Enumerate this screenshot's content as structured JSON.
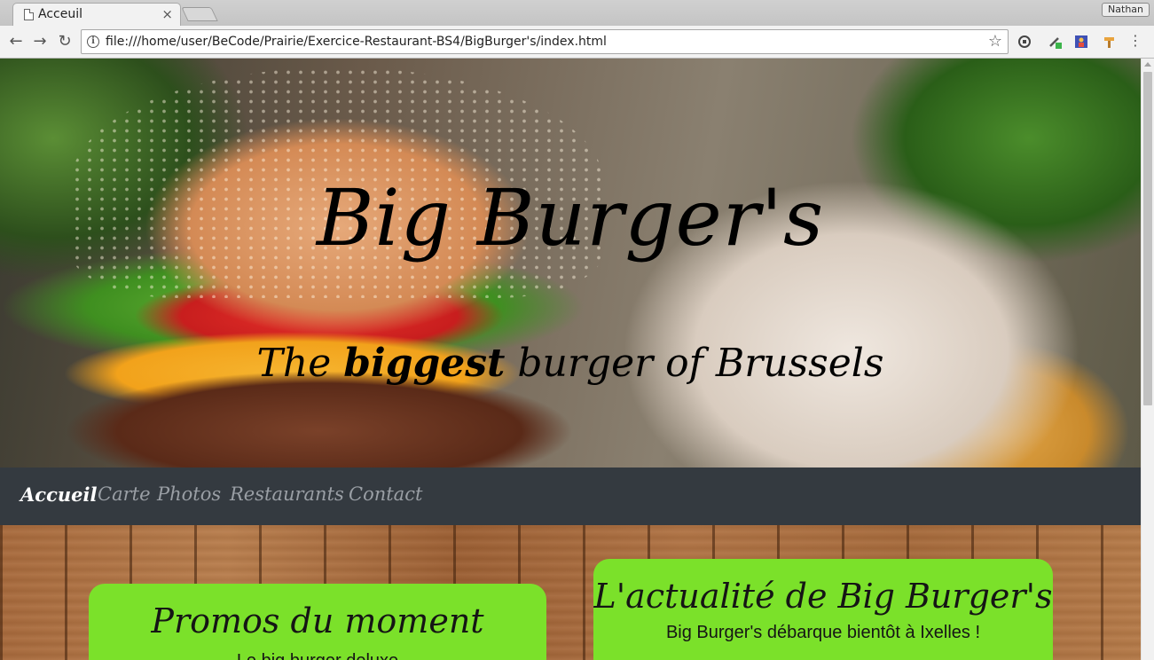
{
  "browser": {
    "tab_title": "Acceuil",
    "tab_close": "×",
    "profile_name": "Nathan",
    "url": "file:///home/user/BeCode/Prairie/Exercice-Restaurant-BS4/BigBurger's/index.html",
    "icons": [
      "page-icon",
      "close-icon",
      "back-icon",
      "forward-icon",
      "reload-icon",
      "info-icon",
      "star-icon",
      "extension-icon",
      "menu-icon"
    ]
  },
  "hero": {
    "title": "Big Burger's",
    "subtitle_pre": "The ",
    "subtitle_bold": "biggest",
    "subtitle_post": " burger of Brussels"
  },
  "nav": {
    "items": [
      "Accueil",
      "Carte",
      "Photos",
      "Restaurants",
      "Contact"
    ],
    "active": "Accueil"
  },
  "cards": {
    "promos": {
      "title": "Promos du moment",
      "text": "Le big burger deluxe"
    },
    "news": {
      "title": "L'actualité de Big Burger's",
      "text": "Big Burger's débarque bientôt à Ixelles !"
    }
  },
  "colors": {
    "navbar": "#343a40",
    "card": "#7be12a",
    "nav_inactive": "#9a9fa5",
    "nav_active": "#ffffff"
  }
}
